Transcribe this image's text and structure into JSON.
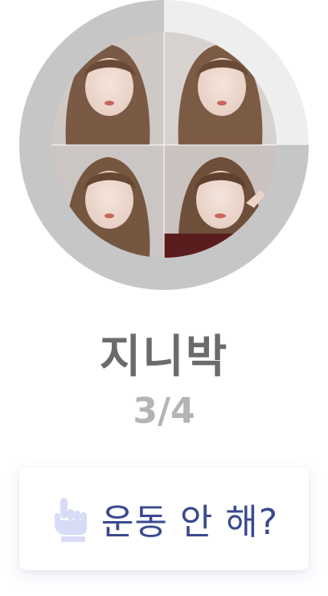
{
  "profile": {
    "name": "지니박",
    "progress_text": "3/4",
    "progress": {
      "completed": 3,
      "total": 4
    }
  },
  "action": {
    "label": "운동 안 해?",
    "icon": "hand-pointer-icon"
  },
  "colors": {
    "ring_filled": "#c6c6c6",
    "ring_empty": "#eeeeee",
    "name": "#6b6b6b",
    "progress_text": "#b4b4b4",
    "action_text": "#3b4a8f",
    "hand_icon": "#d9dcf6"
  }
}
